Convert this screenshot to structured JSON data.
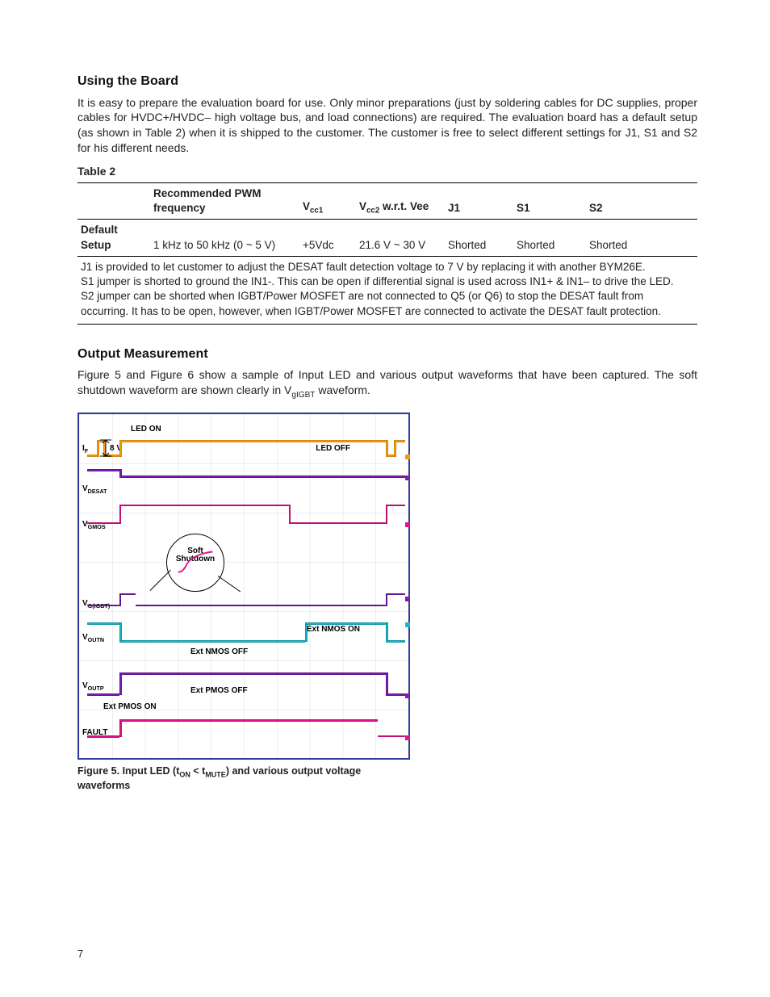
{
  "section1": {
    "heading": "Using the Board",
    "para": "It is easy to prepare the evaluation board for use. Only minor preparations (just by soldering cables for DC supplies, proper cables for HVDC+/HVDC– high voltage bus, and load connections) are required.  The evaluation board has a default setup (as shown in Table 2) when it is shipped to the customer.  The customer is free to select different settings for J1, S1 and S2 for his different needs."
  },
  "table": {
    "label": "Table 2",
    "headers": {
      "c0": "",
      "c1": "Recommended PWM frequency",
      "c2_pre": "V",
      "c2_sub": "cc1",
      "c3_pre": "V",
      "c3_sub": "cc2",
      "c3_post": " w.r.t. Vee",
      "c4": "J1",
      "c5": "S1",
      "c6": "S2"
    },
    "row": {
      "c0": "Default Setup",
      "c1": "1 kHz to 50 kHz (0 ~ 5 V)",
      "c2": "+5Vdc",
      "c3": "21.6 V ~ 30 V",
      "c4": "Shorted",
      "c5": "Shorted",
      "c6": "Shorted"
    },
    "notes": {
      "n1": "J1 is provided to let customer to adjust the DESAT fault detection voltage to 7 V by replacing it with another BYM26E.",
      "n2": "S1 jumper is shorted to ground the IN1-.  This can be open if differential signal is used across IN1+ & IN1– to drive the LED.",
      "n3": "S2 jumper can be shorted when IGBT/Power MOSFET are not connected to Q5 (or Q6) to stop the DESAT fault from occurring. It has to be open, however, when IGBT/Power MOSFET are connected to activate the DESAT fault protection."
    }
  },
  "section2": {
    "heading": "Output Measurement",
    "para_a": "Figure 5 and Figure 6 show a sample of Input LED and various output waveforms that have been captured.  The soft shutdown waveform are shown clearly in V",
    "para_sub": "gIGBT",
    "para_b": " waveform."
  },
  "figure": {
    "labels": {
      "led_on": "LED ON",
      "led_off": "LED OFF",
      "eight_v": "8 V",
      "if_pre": "I",
      "if_sub": "F",
      "vdesat_pre": "V",
      "vdesat_sub": "DESAT",
      "vgmos_pre": "V",
      "vgmos_sub": "GMOS",
      "vgigbt_pre": "V",
      "vgigbt_sub": "G(IGBT)",
      "voutn_pre": "V",
      "voutn_sub": "OUTN",
      "voutp_pre": "V",
      "voutp_sub": "OUTP",
      "fault": "FAULT",
      "soft1": "Soft",
      "soft2": "Shutdown",
      "ext_nmos_on": "Ext NMOS ON",
      "ext_nmos_off": "Ext NMOS OFF",
      "ext_pmos_on": "Ext PMOS ON",
      "ext_pmos_off": "Ext PMOS OFF"
    },
    "caption_a": "Figure 5.  Input LED (t",
    "caption_sub1": "ON",
    "caption_b": " < t",
    "caption_sub2": "MUTE",
    "caption_c": ") and various output voltage waveforms"
  },
  "page": "7"
}
